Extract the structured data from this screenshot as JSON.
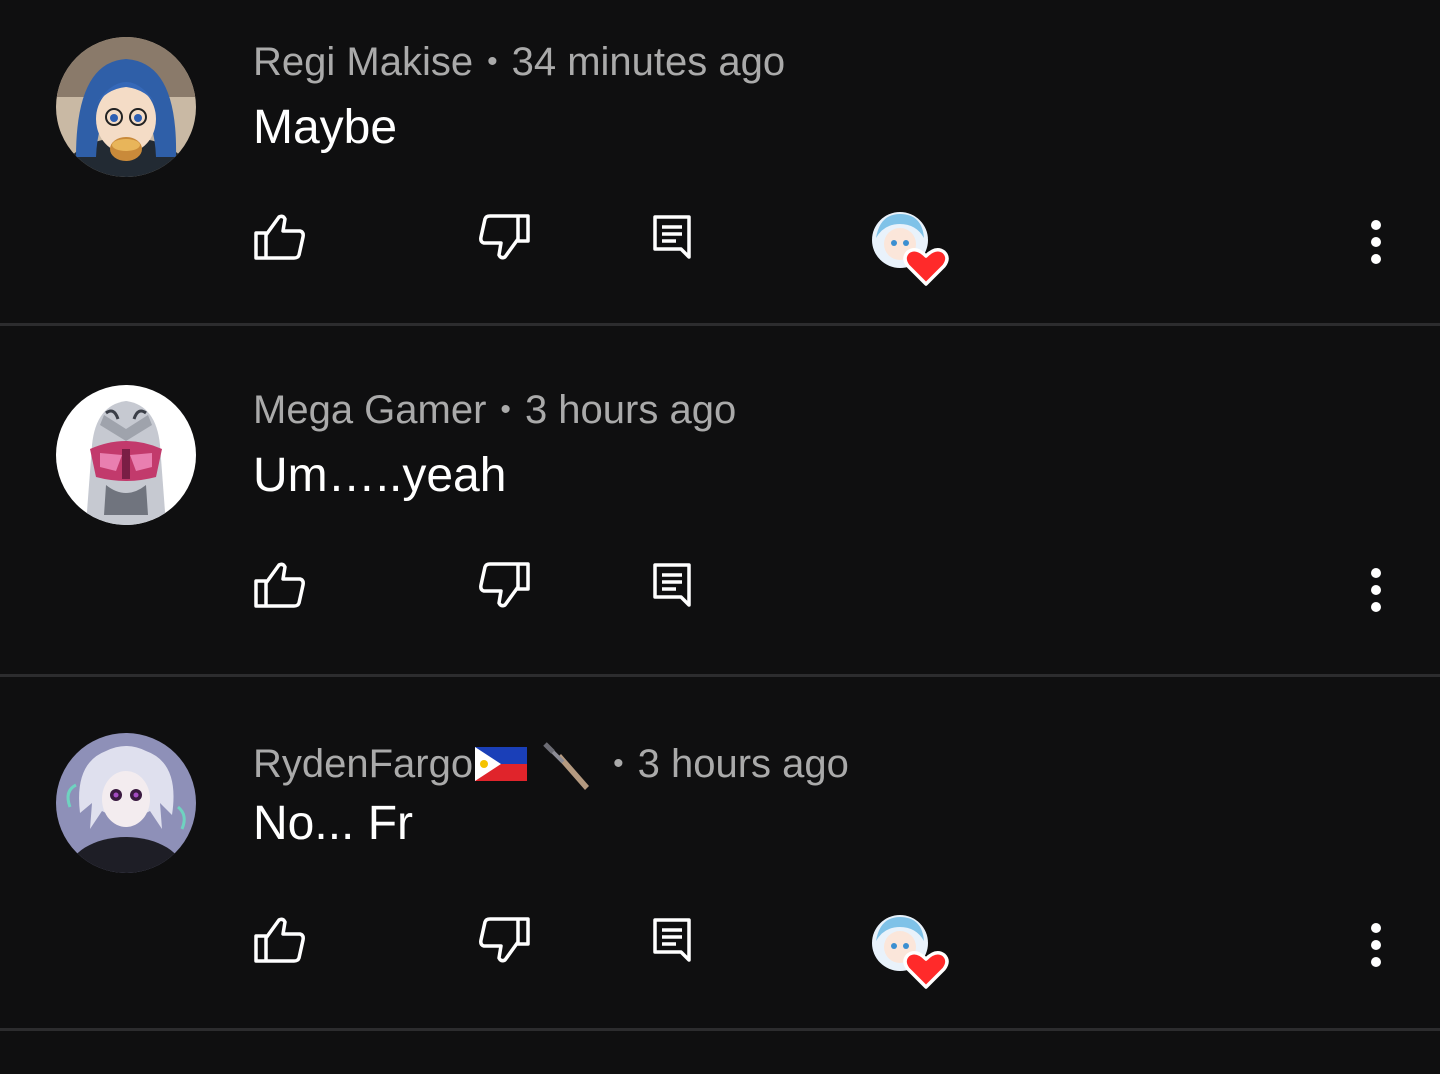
{
  "comments": [
    {
      "author": "Regi Makise",
      "separator": "•",
      "time": "34 minutes ago",
      "text": "Maybe",
      "avatar_icon": "anime-girl-glasses-avatar",
      "hearted": true
    },
    {
      "author": "Mega Gamer",
      "separator": "•",
      "time": "3 hours ago",
      "text": "Um…..yeah",
      "avatar_icon": "rider-helmet-avatar",
      "hearted": false
    },
    {
      "author": "RydenFargo",
      "separator": "•",
      "time": "3 hours ago",
      "text": "No... Fr",
      "avatar_icon": "white-haired-character-avatar",
      "author_badges": [
        "philippines-flag-icon",
        "dagger-icon"
      ],
      "hearted": true
    }
  ],
  "icons": {
    "like": "thumbs-up-icon",
    "dislike": "thumbs-down-icon",
    "reply": "reply-comment-icon",
    "heart": "creator-heart-icon",
    "more": "more-vertical-icon"
  },
  "colors": {
    "background": "#0f0f10",
    "divider": "#2c2c2e",
    "meta_text": "#aaaaaa",
    "body_text": "#ffffff",
    "heart": "#ff2a2a"
  }
}
